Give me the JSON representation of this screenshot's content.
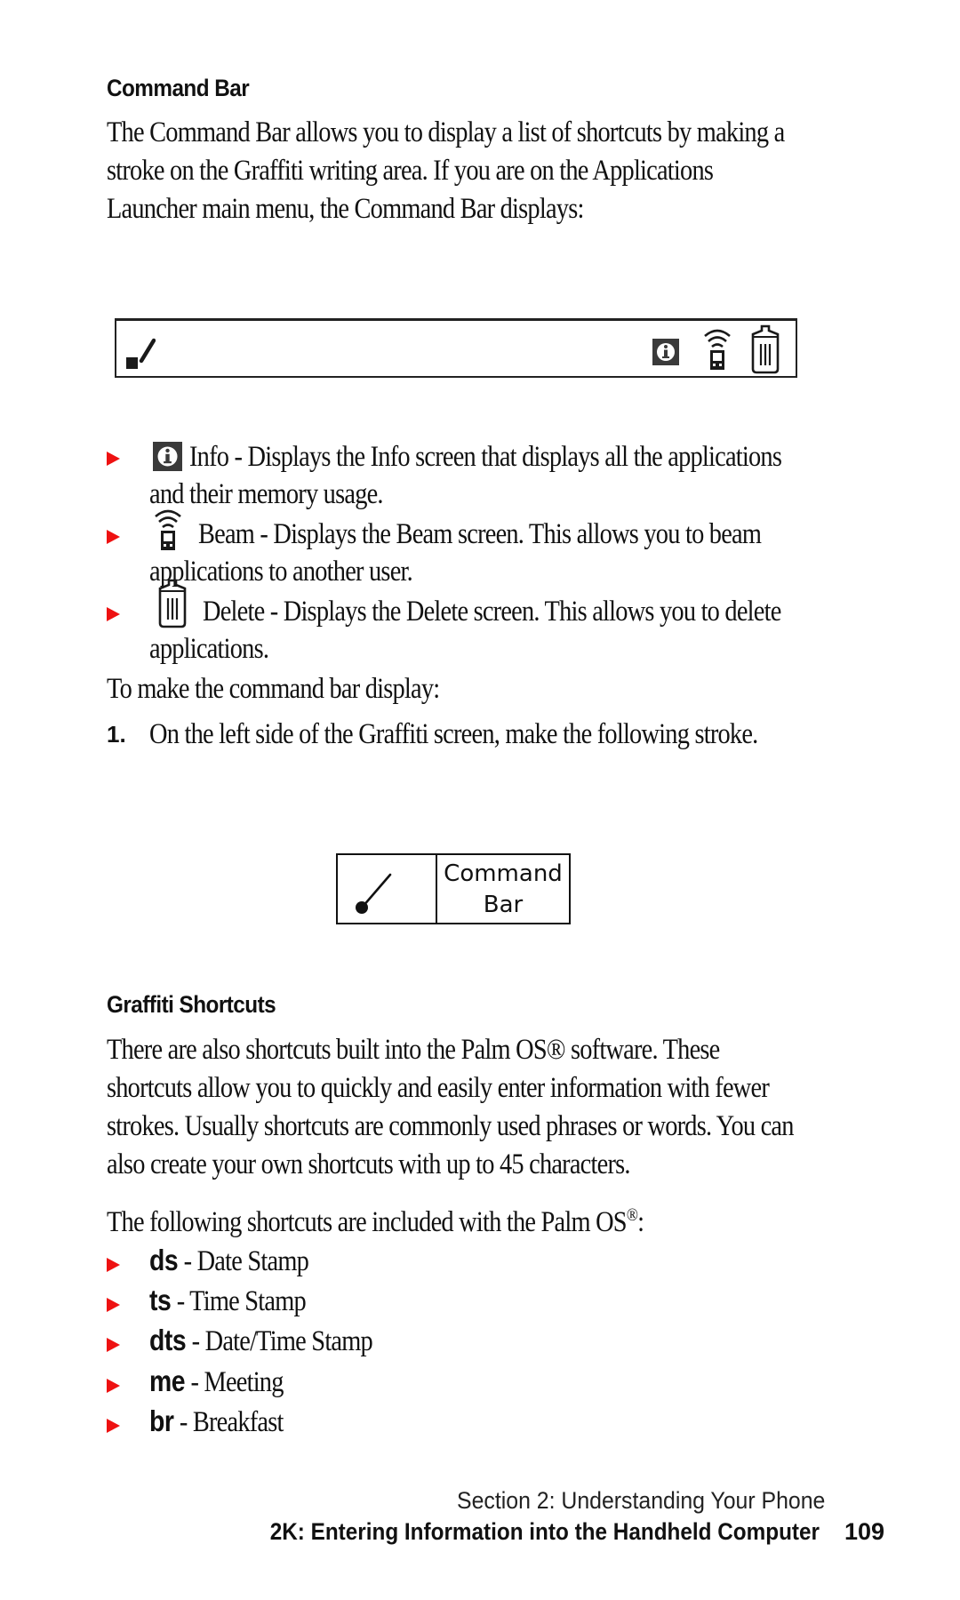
{
  "section1": {
    "heading": "Command Bar",
    "paragraph_lines": [
      "The Command Bar allows you to display a list of shortcuts by making a",
      "stroke on the Graffiti writing area. If you are on the Applications",
      "Launcher main menu, the Command Bar displays:"
    ]
  },
  "command_bar_figure": {
    "icons": [
      "stroke-icon",
      "info-icon",
      "beam-icon",
      "delete-icon"
    ]
  },
  "icon_bullets": [
    {
      "icon": "info-icon",
      "line1": "Info - Displays the Info screen that displays all the applications",
      "line2": "and their memory usage."
    },
    {
      "icon": "beam-icon",
      "line1": "Beam - Displays the Beam screen. This allows you to beam",
      "line2": "applications to another user."
    },
    {
      "icon": "delete-icon",
      "line1": "Delete - Displays the Delete screen. This allows you to delete",
      "line2": "applications."
    }
  ],
  "instructions": {
    "intro": "To make the command bar display:",
    "steps": [
      {
        "number": "1.",
        "text": "On the left side of the Graffiti screen, make the following stroke."
      }
    ]
  },
  "stroke_figure": {
    "label_line1": "Command",
    "label_line2": "Bar"
  },
  "section2": {
    "heading": "Graffiti Shortcuts",
    "paragraph_lines": [
      "There are also shortcuts built into the Palm OS® software. These",
      "shortcuts allow you to quickly and easily enter information with fewer",
      "strokes. Usually shortcuts are commonly used phrases or words. You can",
      "also create your own shortcuts with up to 45 characters."
    ],
    "shortcuts_intro": "The following shortcuts are included with the Palm OS",
    "shortcuts_intro_sup": "®",
    "shortcuts_intro_end": ":",
    "shortcuts": [
      {
        "key": "ds",
        "desc": " - Date Stamp"
      },
      {
        "key": "ts",
        "desc": " - Time Stamp"
      },
      {
        "key": "dts",
        "desc": " - Date/Time Stamp"
      },
      {
        "key": "me",
        "desc": " - Meeting"
      },
      {
        "key": "br",
        "desc": " - Breakfast"
      }
    ]
  },
  "footer": {
    "section": "Section 2: Understanding Your Phone",
    "chapter": "2K: Entering Information into the Handheld Computer",
    "page_number": "109"
  },
  "colors": {
    "bullet": "#ee1111",
    "text": "#111111"
  }
}
